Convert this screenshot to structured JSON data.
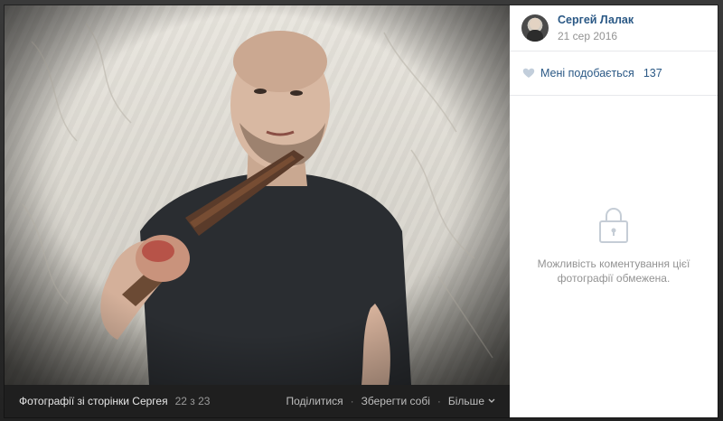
{
  "caption": {
    "album_title": "Фотографії зі сторінки Сергея",
    "counter": "22 з 23",
    "share_label": "Поділитися",
    "save_label": "Зберегти собі",
    "more_label": "Більше",
    "separator": "·"
  },
  "author": {
    "name": "Сергей Лалак",
    "date": "21 сер 2016"
  },
  "likes": {
    "label": "Мені подобається",
    "count": "137"
  },
  "comments": {
    "restricted_line1": "Можливість коментування цієї",
    "restricted_line2": "фотографії обмежена."
  },
  "icons": {
    "heart": "heart-icon",
    "lock": "lock-icon",
    "chevron": "chevron-down-icon"
  },
  "colors": {
    "link": "#2a5885",
    "muted": "#939393",
    "caption_bar": "#1f1f1f"
  }
}
